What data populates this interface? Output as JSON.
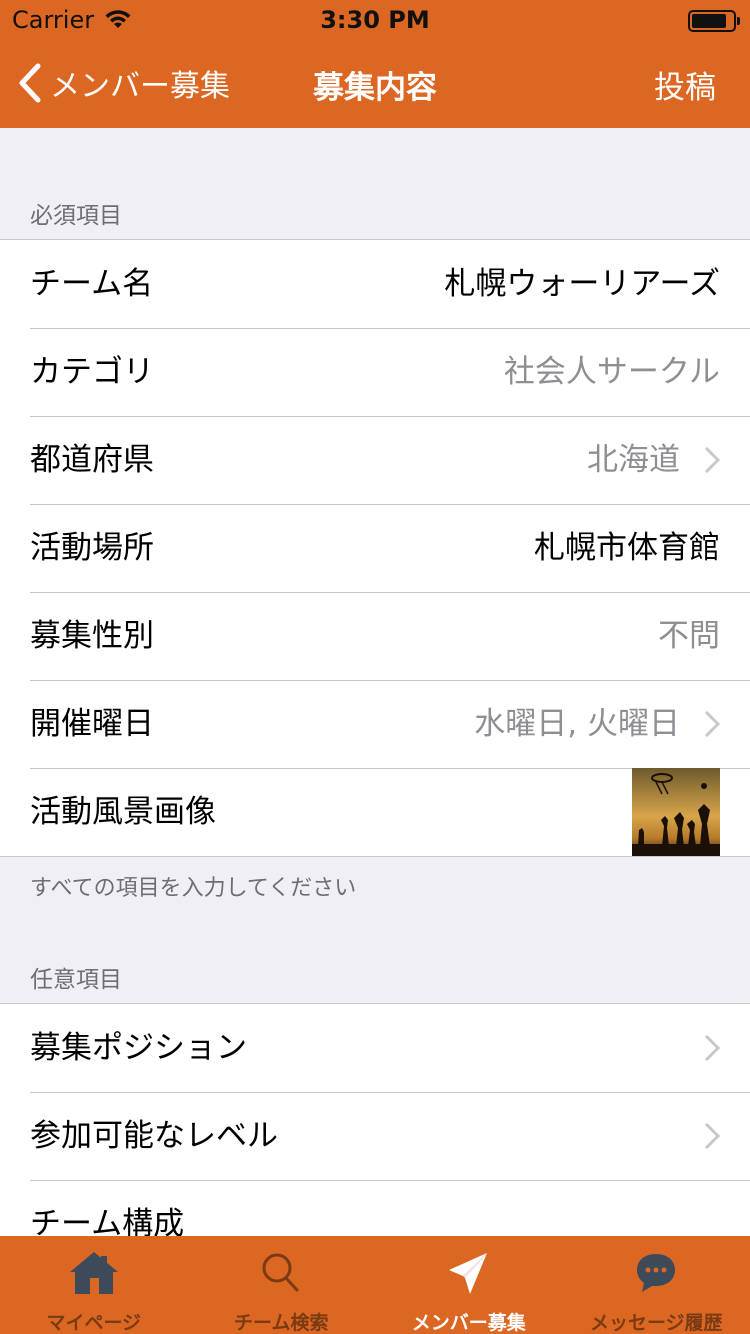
{
  "status_bar": {
    "carrier": "Carrier",
    "time": "3:30 PM",
    "battery_level": 0.85
  },
  "nav": {
    "back_label": "メンバー募集",
    "title": "募集内容",
    "post_label": "投稿"
  },
  "required": {
    "header": "必須項目",
    "rows": [
      {
        "label": "チーム名",
        "value": "札幌ウォーリアーズ"
      },
      {
        "label": "カテゴリ",
        "value": "社会人サークル"
      },
      {
        "label": "都道府県",
        "value": "北海道"
      },
      {
        "label": "活動場所",
        "value": "札幌市体育館"
      },
      {
        "label": "募集性別",
        "value": "不問"
      },
      {
        "label": "開催曜日",
        "value": "水曜日, 火曜日"
      },
      {
        "label": "活動風景画像"
      }
    ],
    "footer": "すべての項目を入力してください"
  },
  "optional": {
    "header": "任意項目",
    "rows": [
      {
        "label": "募集ポジション"
      },
      {
        "label": "参加可能なレベル"
      },
      {
        "label": "チーム構成"
      }
    ]
  },
  "tabs": [
    {
      "label": "マイページ",
      "icon": "house-icon"
    },
    {
      "label": "チーム検索",
      "icon": "search-icon"
    },
    {
      "label": "メンバー募集",
      "icon": "paper-plane-icon",
      "active": true
    },
    {
      "label": "メッセージ履歴",
      "icon": "chat-bubble-icon"
    }
  ],
  "colors": {
    "accent": "#dc6723",
    "tab_inactive": "#7a3a12",
    "background": "#efeff4"
  }
}
